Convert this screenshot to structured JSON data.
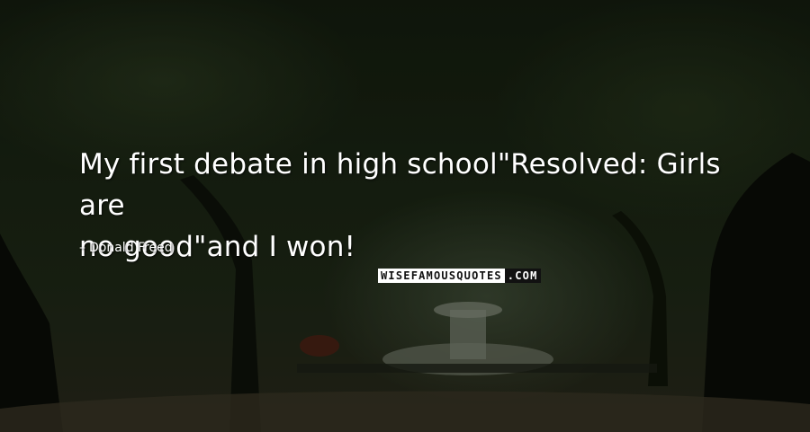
{
  "quote": {
    "line1": "My first debate in high school\"Resolved: Girls are",
    "line2": "no good\"and I won!"
  },
  "author": {
    "name": "Donald Freed",
    "icon": "dash-icon"
  },
  "logo": {
    "part1": "WISEFAMOUSQUOTES",
    "part2": ".COM"
  },
  "colors": {
    "text": "#ffffff",
    "foliage": "#1b2614",
    "path": "#2a2a1c"
  }
}
